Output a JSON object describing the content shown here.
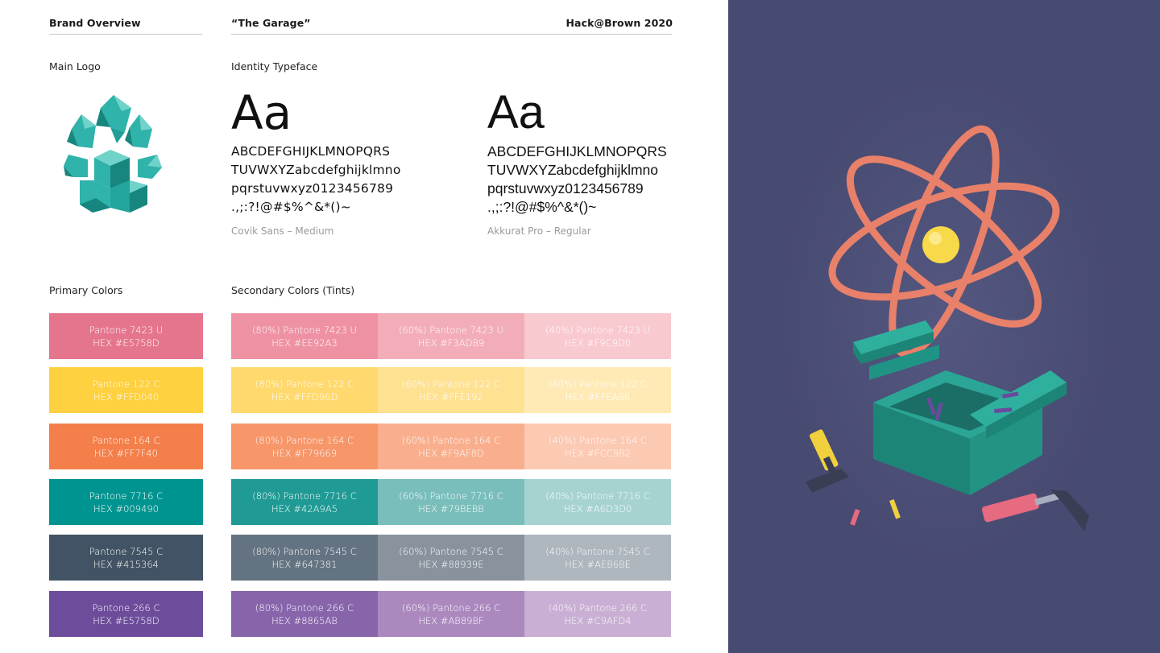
{
  "header": {
    "left": "Brand Overview",
    "center": "“The Garage”",
    "right": "Hack@Brown 2020"
  },
  "sections": {
    "main_logo": "Main Logo",
    "identity_typeface": "Identity Typeface",
    "primary_colors": "Primary Colors",
    "secondary_colors": "Secondary Colors (Tints)"
  },
  "typefaces": [
    {
      "sample": "Aa",
      "lines": [
        "ABCDEFGHIJKLMNOPQRS",
        "TUVWXYZabcdefghijklmno",
        "pqrstuvwxyz0123456789",
        ".,;:?!@#$%^&*()~"
      ],
      "name": "Covik Sans – Medium"
    },
    {
      "sample": "Aa",
      "lines": [
        "ABCDEFGHIJKLMNOPQRS",
        "TUVWXYZabcdefghijklmno",
        "pqrstuvwxyz0123456789",
        ".,;:?!@#$%^&*()~"
      ],
      "name": "Akkurat Pro – Regular"
    }
  ],
  "colors": {
    "logo_teal": "#2fb3aa",
    "logo_teal_dark": "#16867f",
    "logo_teal_light": "#6fd3c9",
    "illustration_bg": "#474a71"
  },
  "primary": [
    {
      "pantone": "Pantone 7423 U",
      "hex": "HEX #E5758D",
      "color": "#E5758D"
    },
    {
      "pantone": "Pantone 122 C",
      "hex": "HEX #FFD040",
      "color": "#FFD040"
    },
    {
      "pantone": "Pantone 164 C",
      "hex": "HEX #FF7F40",
      "color": "#F57F4A"
    },
    {
      "pantone": "Pantone 7716 C",
      "hex": "HEX #009490",
      "color": "#009490"
    },
    {
      "pantone": "Pantone 7545 C",
      "hex": "HEX #415364",
      "color": "#415364"
    },
    {
      "pantone": "Pantone 266 C",
      "hex": "HEX #E5758D",
      "color": "#6D4C9B"
    }
  ],
  "tints": [
    [
      {
        "pantone": "(80%) Pantone 7423 U",
        "hex": "HEX #EE92A3",
        "color": "#EE92A3"
      },
      {
        "pantone": "(60%) Pantone 7423 U",
        "hex": "HEX #F3ADB9",
        "color": "#F3ADB9"
      },
      {
        "pantone": "(40%) Pantone 7423 U",
        "hex": "HEX #F9C9D0",
        "color": "#F9C9D0"
      }
    ],
    [
      {
        "pantone": "(80%) Pantone 122 C",
        "hex": "HEX #FFD96D",
        "color": "#FFD96D"
      },
      {
        "pantone": "(60%) Pantone 122 C",
        "hex": "HEX #FFE192",
        "color": "#FFE192"
      },
      {
        "pantone": "(40%) Pantone 122 C",
        "hex": "HEX #FFEAB6",
        "color": "#FFEAB6"
      }
    ],
    [
      {
        "pantone": "(80%) Pantone 164 C",
        "hex": "HEX #F79669",
        "color": "#F79669"
      },
      {
        "pantone": "(60%) Pantone 164 C",
        "hex": "HEX #F9AF8D",
        "color": "#F9AF8D"
      },
      {
        "pantone": "(40%) Pantone 164 C",
        "hex": "HEX #FCC9B2",
        "color": "#FCC9B2"
      }
    ],
    [
      {
        "pantone": "(80%) Pantone 7716 C",
        "hex": "HEX #42A9A5",
        "color": "#1F9A95"
      },
      {
        "pantone": "(60%) Pantone 7716 C",
        "hex": "HEX #79BEBB",
        "color": "#79BEBB"
      },
      {
        "pantone": "(40%) Pantone 7716 C",
        "hex": "HEX #A6D3D0",
        "color": "#A6D3D0"
      }
    ],
    [
      {
        "pantone": "(80%) Pantone 7545 C",
        "hex": "HEX #647381",
        "color": "#647381"
      },
      {
        "pantone": "(60%) Pantone 7545 C",
        "hex": "HEX #88939E",
        "color": "#88939E"
      },
      {
        "pantone": "(40%) Pantone 7545 C",
        "hex": "HEX #AEB6BE",
        "color": "#AEB6BE"
      }
    ],
    [
      {
        "pantone": "(80%) Pantone 266 C",
        "hex": "HEX #8865AB",
        "color": "#8865AB"
      },
      {
        "pantone": "(60%) Pantone 266 C",
        "hex": "HEX #AB89BF",
        "color": "#AB89BF"
      },
      {
        "pantone": "(40%) Pantone 266 C",
        "hex": "HEX #C9AFD4",
        "color": "#C9AFD4"
      }
    ]
  ]
}
